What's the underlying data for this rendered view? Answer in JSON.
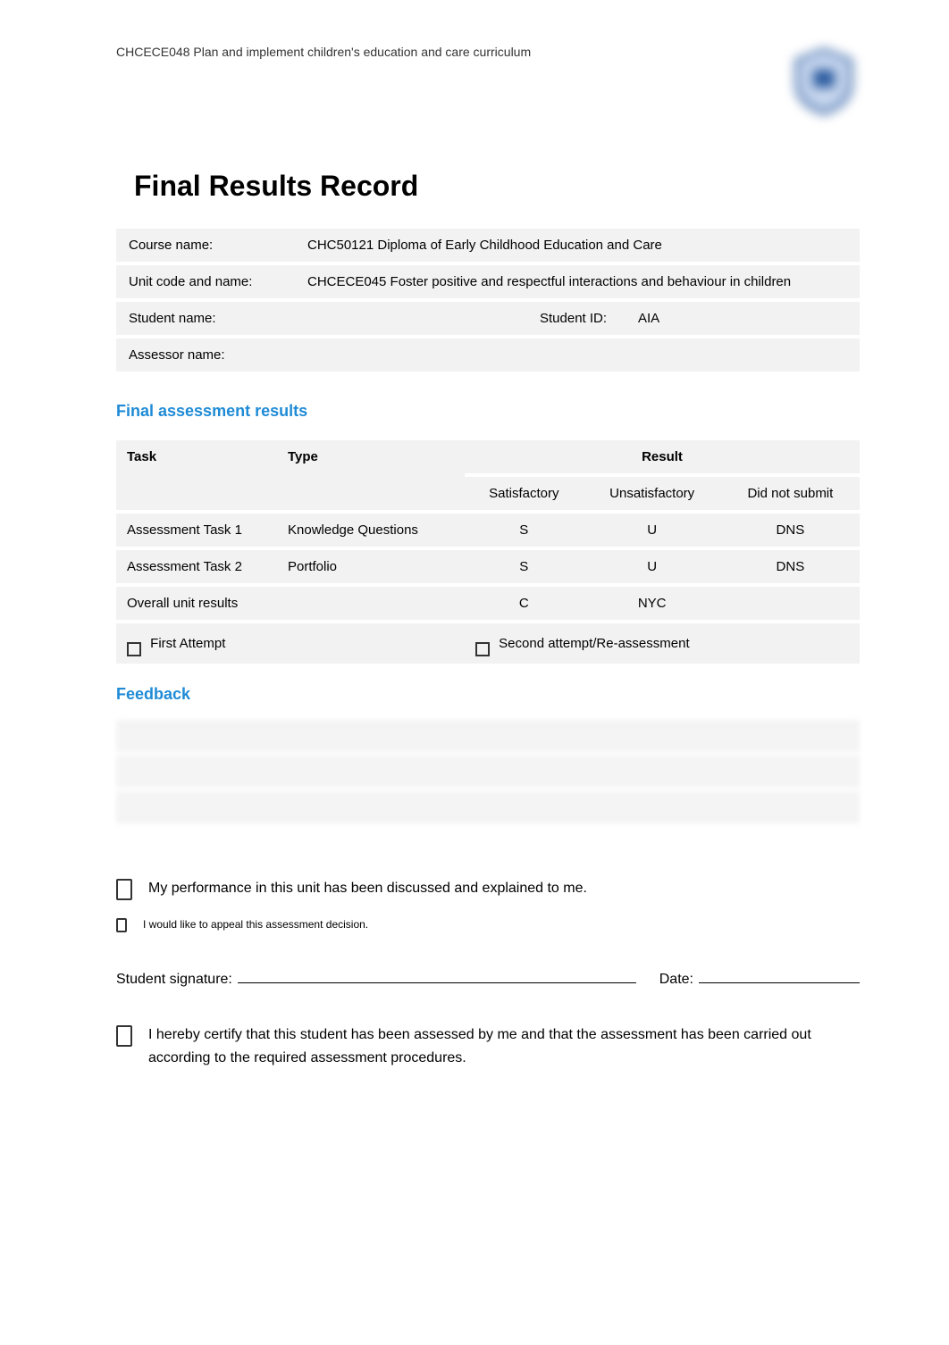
{
  "header": {
    "unit_ref": "CHCECE048 Plan and implement children's education and care curriculum"
  },
  "title": "Final Results Record",
  "info": {
    "course_label": "Course name:",
    "course_value": "CHC50121 Diploma of Early Childhood Education and Care",
    "unit_label": "Unit code and name:",
    "unit_value": "CHCECE045 Foster positive and respectful interactions and behaviour in children",
    "student_label": "Student name:",
    "student_value": "",
    "student_id_label": "Student ID:",
    "student_id_value": "AIA",
    "assessor_label": "Assessor name:",
    "assessor_value": ""
  },
  "results_heading": "Final assessment results",
  "results_table": {
    "headers": {
      "task": "Task",
      "type": "Type",
      "result": "Result",
      "sat": "Satisfactory",
      "unsat": "Unsatisfactory",
      "dns": "Did not submit"
    },
    "rows": [
      {
        "task": "Assessment Task 1",
        "type": "Knowledge Questions",
        "sat": "S",
        "unsat": "U",
        "dns": "DNS"
      },
      {
        "task": "Assessment Task 2",
        "type": "Portfolio",
        "sat": "S",
        "unsat": "U",
        "dns": "DNS"
      },
      {
        "task": "Overall unit results",
        "type": "",
        "sat": "C",
        "unsat": "NYC",
        "dns": ""
      }
    ],
    "attempt": {
      "first": "First Attempt",
      "second": "Second attempt/Re-assessment"
    }
  },
  "feedback_heading": "Feedback",
  "declarations": {
    "performance": "My performance in this unit has been discussed and explained to me.",
    "appeal": "I would like to appeal this assessment decision.",
    "certify": "I hereby certify that this student has been assessed by me and that the assessment has been carried out according to the required assessment procedures."
  },
  "signature": {
    "student_label": "Student signature:",
    "date_label": "Date:"
  }
}
